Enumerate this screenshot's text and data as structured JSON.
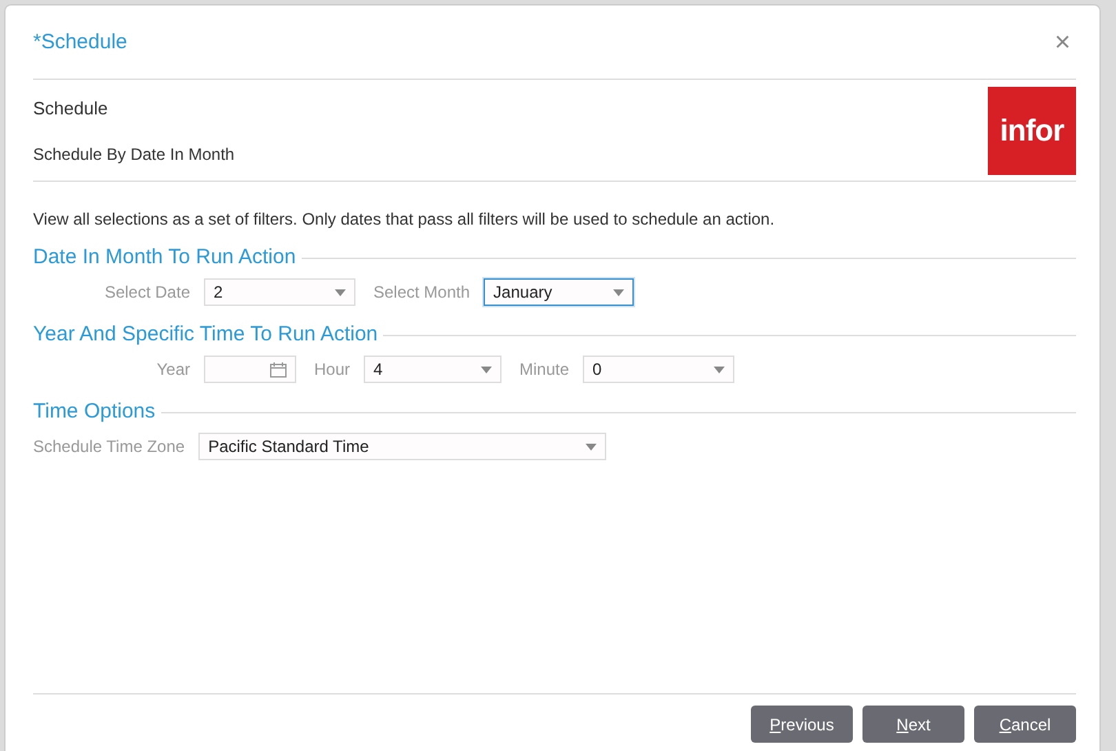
{
  "dialog": {
    "title": "*Schedule",
    "close": "×"
  },
  "header": {
    "title": "Schedule",
    "subtitle": "Schedule By Date In Month",
    "logo": "infor"
  },
  "description": "View all selections as a set of filters. Only dates that pass all filters will be used to schedule an action.",
  "sections": [
    {
      "title": "Date In Month To Run Action",
      "fields": [
        {
          "label": "Select Date",
          "kind": "select",
          "value": "2",
          "focused": false
        },
        {
          "label": "Select Month",
          "kind": "select",
          "value": "January",
          "focused": true
        }
      ]
    },
    {
      "title": "Year And Specific Time To Run Action",
      "fields": [
        {
          "label": "Year",
          "kind": "date",
          "focused": false
        },
        {
          "label": "Hour",
          "kind": "select",
          "value": "4",
          "focused": false
        },
        {
          "label": "Minute",
          "kind": "select",
          "value": "0",
          "focused": false
        }
      ]
    },
    {
      "title": "Time Options",
      "fields": [
        {
          "label": "Schedule Time Zone",
          "kind": "select",
          "value": "Pacific Standard Time",
          "focused": false
        }
      ]
    }
  ],
  "buttons": [
    {
      "access_key": "P",
      "rest": "revious"
    },
    {
      "access_key": "N",
      "rest": "ext"
    },
    {
      "access_key": "C",
      "rest": "ancel"
    }
  ]
}
